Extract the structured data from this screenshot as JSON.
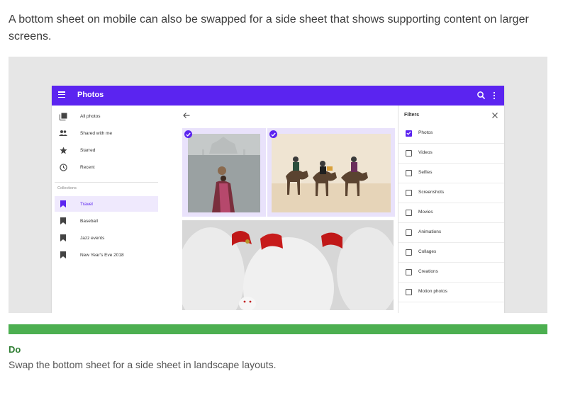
{
  "intro_text": "A bottom sheet on mobile can also be swapped for a side sheet that shows supporting content on larger screens.",
  "app": {
    "title": "Photos",
    "accent_color": "#5b24f0",
    "nav": {
      "items": [
        {
          "label": "All photos",
          "icon": "photo-library-icon"
        },
        {
          "label": "Shared with me",
          "icon": "people-icon"
        },
        {
          "label": "Starred",
          "icon": "star-icon"
        },
        {
          "label": "Recent",
          "icon": "clock-icon"
        }
      ],
      "collections_heading": "Collections",
      "collections": [
        {
          "label": "Travel",
          "icon": "bookmark-icon",
          "active": true
        },
        {
          "label": "Baseball",
          "icon": "bookmark-icon"
        },
        {
          "label": "Jazz events",
          "icon": "bookmark-icon"
        },
        {
          "label": "New Year's Eve 2018",
          "icon": "bookmark-icon"
        }
      ]
    },
    "photos": [
      {
        "subject": "woman-carrying-pot-photo",
        "selected": true
      },
      {
        "subject": "camel-riders-photo",
        "selected": true
      },
      {
        "subject": "lucky-cat-figurines-photo",
        "selected": false
      }
    ],
    "filters": {
      "title": "Filters",
      "items": [
        {
          "label": "Photos",
          "checked": true
        },
        {
          "label": "Videos",
          "checked": false
        },
        {
          "label": "Selfies",
          "checked": false
        },
        {
          "label": "Screenshots",
          "checked": false
        },
        {
          "label": "Movies",
          "checked": false
        },
        {
          "label": "Animations",
          "checked": false
        },
        {
          "label": "Collages",
          "checked": false
        },
        {
          "label": "Creations",
          "checked": false
        },
        {
          "label": "Motion photos",
          "checked": false
        }
      ]
    }
  },
  "guideline": {
    "label": "Do",
    "text": "Swap the bottom sheet for a side sheet in landscape layouts.",
    "color": "#4caf50"
  }
}
